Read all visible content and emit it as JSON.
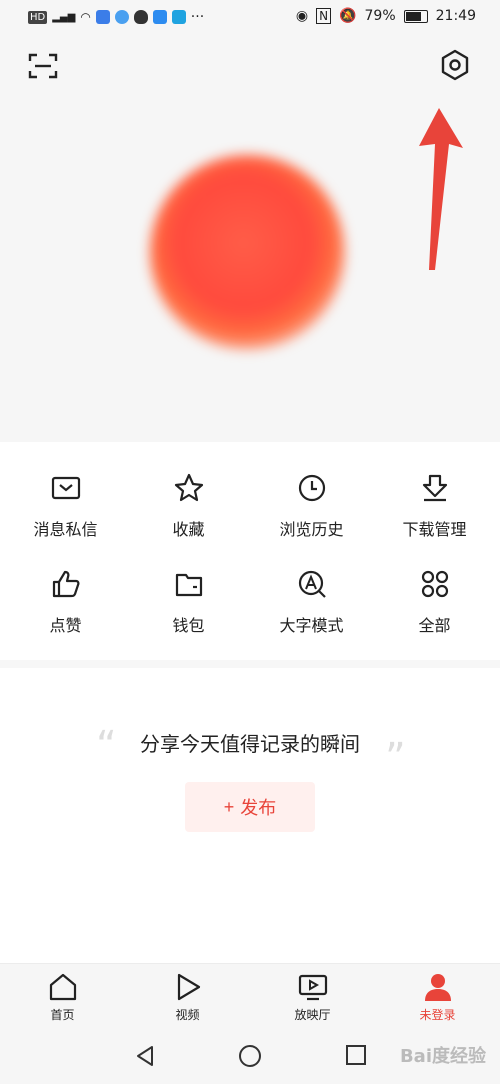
{
  "status_bar": {
    "left_icons": [
      "HD",
      "4G signal",
      "wifi",
      "app",
      "music",
      "qq",
      "app",
      "app"
    ],
    "more": "···",
    "battery": "79%",
    "time": "21:49",
    "right_icons": [
      "eye-icon",
      "nfc-icon",
      "mute-icon",
      "battery-icon"
    ]
  },
  "header": {
    "scan_icon": "scan-icon",
    "settings_icon": "settings-icon"
  },
  "quick_actions": [
    {
      "label": "消息私信",
      "icon": "message-icon"
    },
    {
      "label": "收藏",
      "icon": "star-icon"
    },
    {
      "label": "浏览历史",
      "icon": "clock-icon"
    },
    {
      "label": "下载管理",
      "icon": "download-icon"
    },
    {
      "label": "点赞",
      "icon": "thumb-up-icon"
    },
    {
      "label": "钱包",
      "icon": "wallet-icon"
    },
    {
      "label": "大字模式",
      "icon": "large-font-icon"
    },
    {
      "label": "全部",
      "icon": "all-grid-icon"
    }
  ],
  "share": {
    "text": "分享今天值得记录的瞬间",
    "publish_label": "发布",
    "publish_plus": "+"
  },
  "tabbar": [
    {
      "label": "首页",
      "icon": "home-icon"
    },
    {
      "label": "视频",
      "icon": "video-play-icon"
    },
    {
      "label": "放映厅",
      "icon": "theater-icon"
    },
    {
      "label": "未登录",
      "icon": "user-icon",
      "active": true
    }
  ],
  "nav": [
    "back-icon",
    "home-circle-icon",
    "recent-square-icon"
  ],
  "watermark": "Bai度经验",
  "colors": {
    "accent": "#e8443a",
    "hero_bg": "#f6f6f6",
    "arrow": "#e8443a"
  }
}
